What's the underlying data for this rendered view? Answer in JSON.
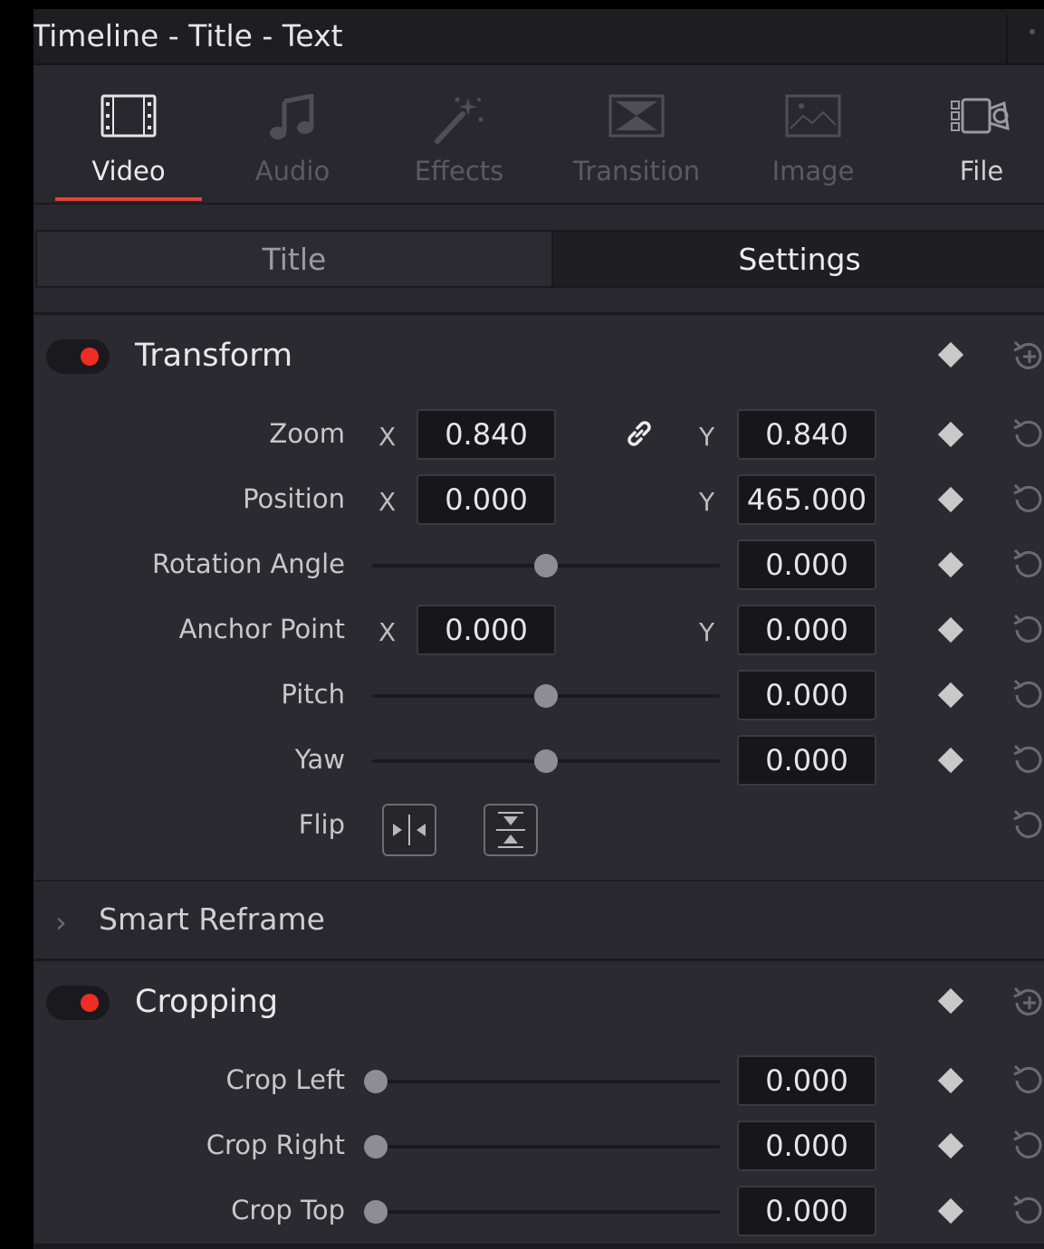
{
  "window": {
    "title": "Timeline - Title - Text"
  },
  "tabs": [
    {
      "label": "Video",
      "icon": "film-icon",
      "state": "active"
    },
    {
      "label": "Audio",
      "icon": "music-note-icon",
      "state": "disabled"
    },
    {
      "label": "Effects",
      "icon": "magic-wand-icon",
      "state": "disabled"
    },
    {
      "label": "Transition",
      "icon": "transition-icon",
      "state": "disabled"
    },
    {
      "label": "Image",
      "icon": "image-icon",
      "state": "disabled"
    },
    {
      "label": "File",
      "icon": "camera-icon",
      "state": "enabled"
    }
  ],
  "subtabs": {
    "title": "Title",
    "settings": "Settings",
    "active": "Settings"
  },
  "transform": {
    "title": "Transform",
    "enabled": true,
    "zoom": {
      "label": "Zoom",
      "x_axis": "X",
      "x": "0.840",
      "y_axis": "Y",
      "y": "0.840",
      "linked": true
    },
    "position": {
      "label": "Position",
      "x_axis": "X",
      "x": "0.000",
      "y_axis": "Y",
      "y": "465.000"
    },
    "rotation": {
      "label": "Rotation Angle",
      "value": "0.000",
      "slider_fraction": 0.5
    },
    "anchor": {
      "label": "Anchor Point",
      "x_axis": "X",
      "x": "0.000",
      "y_axis": "Y",
      "y": "0.000"
    },
    "pitch": {
      "label": "Pitch",
      "value": "0.000",
      "slider_fraction": 0.5
    },
    "yaw": {
      "label": "Yaw",
      "value": "0.000",
      "slider_fraction": 0.5
    },
    "flip": {
      "label": "Flip"
    }
  },
  "smart_reframe": {
    "label": "Smart Reframe"
  },
  "cropping": {
    "title": "Cropping",
    "enabled": true,
    "crop_left": {
      "label": "Crop Left",
      "value": "0.000",
      "slider_fraction": 0
    },
    "crop_right": {
      "label": "Crop Right",
      "value": "0.000",
      "slider_fraction": 0
    },
    "crop_top": {
      "label": "Crop Top",
      "value": "0.000",
      "slider_fraction": 0
    }
  },
  "colors": {
    "accent": "#e2423a",
    "toggle_on": "#ee2d24",
    "panel": "#2a2a30",
    "field": "#17171b"
  }
}
